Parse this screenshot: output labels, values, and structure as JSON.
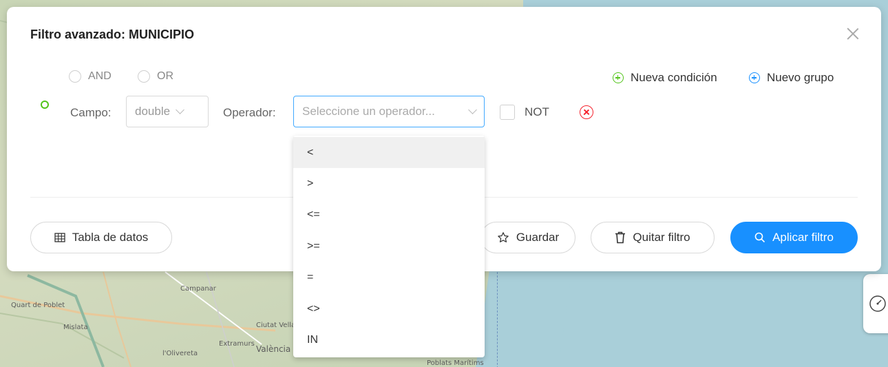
{
  "modal": {
    "title": "Filtro avanzado: MUNICIPIO",
    "close_icon": "close-icon"
  },
  "logic": {
    "and_label": "AND",
    "or_label": "OR"
  },
  "actions": {
    "new_condition": "Nueva condición",
    "new_group": "Nuevo grupo"
  },
  "condition": {
    "field_label": "Campo:",
    "field_value": "double",
    "operator_label": "Operador:",
    "operator_placeholder": "Seleccione un operador...",
    "not_label": "NOT"
  },
  "operators": {
    "options": [
      "<",
      ">",
      "<=",
      ">=",
      "=",
      "<>",
      "IN"
    ],
    "highlighted": "<"
  },
  "footer": {
    "table_button": "Tabla de datos",
    "save_button": "Guardar",
    "clear_button": "Quitar filtro",
    "apply_button": "Aplicar filtro"
  },
  "map": {
    "labels": [
      "Quart de Poblet",
      "Campanar",
      "Mislata",
      "Ciutat Vella",
      "Extramurs",
      "València",
      "l'Olivereta",
      "Poblats Marítims"
    ]
  },
  "colors": {
    "primary": "#1890ff",
    "success": "#52c41a",
    "danger": "#f5222d"
  }
}
